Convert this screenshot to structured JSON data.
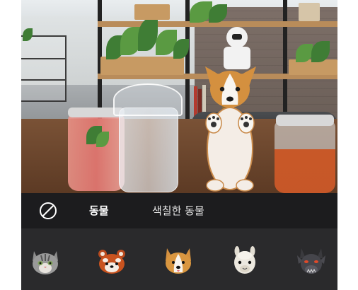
{
  "tabs": {
    "none_icon": "no-effect-icon",
    "items": [
      {
        "label": "동물",
        "active": true
      },
      {
        "label": "색칠한 동물",
        "active": false
      }
    ]
  },
  "stickers": [
    {
      "icon": "cat-face-icon"
    },
    {
      "icon": "red-panda-face-icon"
    },
    {
      "icon": "corgi-face-icon"
    },
    {
      "icon": "llama-face-icon"
    },
    {
      "icon": "dragon-face-icon"
    }
  ],
  "colors": {
    "tab_bar_bg": "#1c1c1e",
    "tray_bg": "#2a2a2c",
    "text": "#ffffff"
  }
}
